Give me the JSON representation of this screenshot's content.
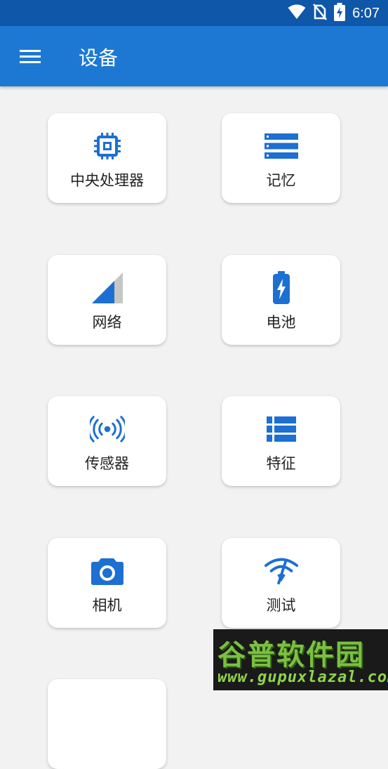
{
  "status_bar": {
    "time": "6:07",
    "icons": [
      "wifi-icon",
      "no-sim-icon",
      "battery-charging-icon"
    ]
  },
  "app_bar": {
    "menu_icon": "menu-icon",
    "title": "设备"
  },
  "colors": {
    "status_bar": "#0f57a8",
    "app_bar": "#1d78d3",
    "icon_blue": "#1d6fd1",
    "background": "#f2f2f2"
  },
  "grid": {
    "items": [
      {
        "label": "中央处理器",
        "icon": "cpu-icon"
      },
      {
        "label": "记忆",
        "icon": "memory-icon"
      },
      {
        "label": "网络",
        "icon": "signal-icon"
      },
      {
        "label": "电池",
        "icon": "battery-icon"
      },
      {
        "label": "传感器",
        "icon": "sensor-icon"
      },
      {
        "label": "特征",
        "icon": "features-list-icon"
      },
      {
        "label": "相机",
        "icon": "camera-icon"
      },
      {
        "label": "测试",
        "icon": "wifi-test-icon"
      }
    ]
  },
  "watermark": {
    "title": "谷普软件园",
    "url": "www.gupuxlazal.com"
  }
}
